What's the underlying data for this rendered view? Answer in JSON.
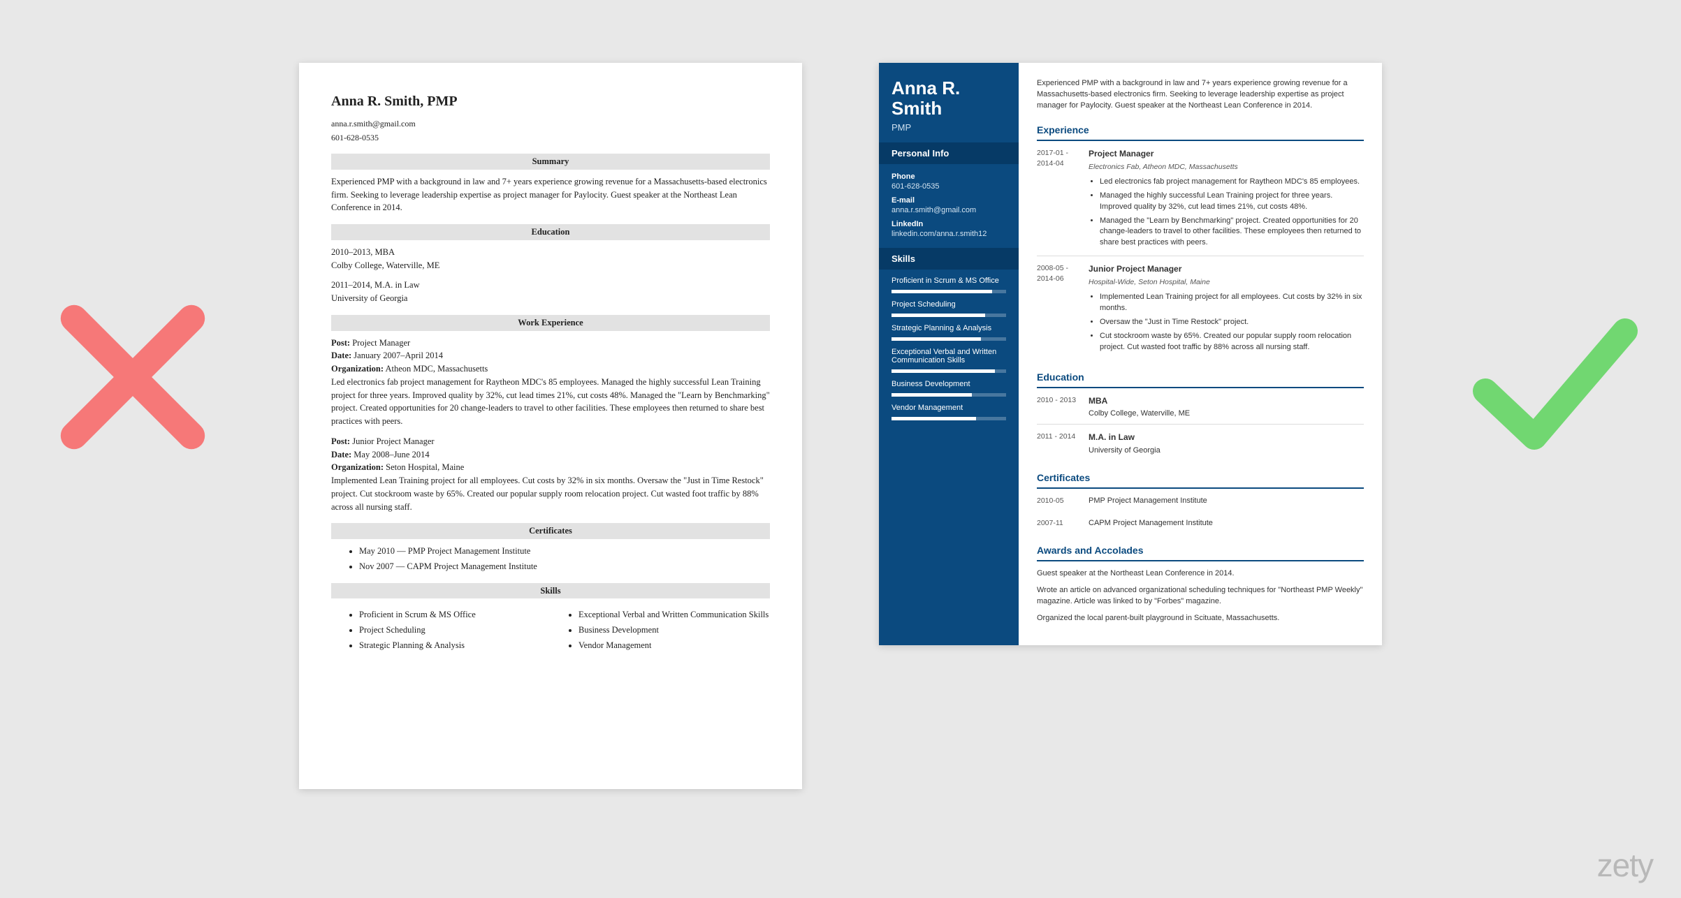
{
  "logo": "zety",
  "left": {
    "name": "Anna R. Smith, PMP",
    "email": "anna.r.smith@gmail.com",
    "phone": "601-628-0535",
    "sections": {
      "summary_h": "Summary",
      "summary": "Experienced PMP with a background in law and 7+ years experience growing revenue for a Massachusetts-based electronics firm. Seeking to leverage leadership expertise as project manager for Paylocity. Guest speaker at the Northeast Lean Conference in 2014.",
      "education_h": "Education",
      "edu1_dates": "2010–2013, MBA",
      "edu1_school": "Colby College, Waterville, ME",
      "edu2_dates": "2011–2014, M.A. in Law",
      "edu2_school": "University of Georgia",
      "work_h": "Work Experience",
      "job1_post_l": "Post:",
      "job1_post": "Project Manager",
      "job1_date_l": "Date:",
      "job1_date": "January 2007–April 2014",
      "job1_org_l": "Organization:",
      "job1_org": "Atheon MDC, Massachusetts",
      "job1_desc": "Led electronics fab project management for Raytheon MDC's 85 employees. Managed the highly successful Lean Training project for three years. Improved quality by 32%, cut lead times 21%, cut costs 48%. Managed the \"Learn by Benchmarking\" project. Created opportunities for 20 change-leaders to travel to other facilities. These employees then returned to share best practices with peers.",
      "job2_post_l": "Post:",
      "job2_post": "Junior Project Manager",
      "job2_date_l": "Date:",
      "job2_date": "May 2008–June 2014",
      "job2_org_l": "Organization:",
      "job2_org": "Seton Hospital, Maine",
      "job2_desc": "Implemented Lean Training project for all employees. Cut costs by 32% in six months. Oversaw the \"Just in Time Restock\" project. Cut stockroom waste by 65%. Created our popular supply room relocation project. Cut wasted foot traffic by 88% across all nursing staff.",
      "cert_h": "Certificates",
      "cert1": "May 2010 — PMP Project Management Institute",
      "cert2": "Nov 2007 — CAPM Project Management Institute",
      "skills_h": "Skills",
      "sk1": "Proficient in Scrum & MS Office",
      "sk2": "Project Scheduling",
      "sk3": "Strategic Planning & Analysis",
      "sk4": "Exceptional Verbal and Written Communication Skills",
      "sk5": "Business Development",
      "sk6": "Vendor Management"
    }
  },
  "right": {
    "name1": "Anna R.",
    "name2": "Smith",
    "cred": "PMP",
    "info_h": "Personal Info",
    "phone_l": "Phone",
    "phone": "601-628-0535",
    "email_l": "E-mail",
    "email": "anna.r.smith@gmail.com",
    "li_l": "LinkedIn",
    "li": "linkedin.com/anna.r.smith12",
    "skills_h": "Skills",
    "skills": [
      {
        "name": "Proficient in Scrum & MS Office",
        "pct": 88
      },
      {
        "name": "Project Scheduling",
        "pct": 82
      },
      {
        "name": "Strategic Planning & Analysis",
        "pct": 78
      },
      {
        "name": "Exceptional Verbal and Written Communication Skills",
        "pct": 90
      },
      {
        "name": "Business Development",
        "pct": 70
      },
      {
        "name": "Vendor Management",
        "pct": 74
      }
    ],
    "summary": "Experienced PMP with a background in law and 7+ years experience growing revenue for a Massachusetts-based electronics firm. Seeking to leverage leadership expertise as project manager for Paylocity. Guest speaker at the Northeast Lean Conference in 2014.",
    "exp_h": "Experience",
    "exp": [
      {
        "dates": "2017-01 - 2014-04",
        "title": "Project Manager",
        "sub": "Electronics Fab, Atheon MDC, Massachusetts",
        "bullets": [
          "Led electronics fab project management for Raytheon MDC's 85 employees.",
          "Managed the highly successful Lean Training project for three years. Improved quality by 32%, cut lead times 21%, cut costs 48%.",
          "Managed the \"Learn by Benchmarking\" project. Created opportunities for 20 change-leaders to travel to other facilities. These employees then returned to share best practices with peers."
        ]
      },
      {
        "dates": "2008-05 - 2014-06",
        "title": "Junior Project Manager",
        "sub": "Hospital-Wide, Seton Hospital, Maine",
        "bullets": [
          "Implemented Lean Training project for all employees. Cut costs by 32% in six months.",
          "Oversaw the \"Just in Time Restock\" project.",
          "Cut stockroom waste by 65%. Created our popular supply room relocation project. Cut wasted foot traffic by 88% across all nursing staff."
        ]
      }
    ],
    "edu_h": "Education",
    "edu": [
      {
        "dates": "2010 - 2013",
        "title": "MBA",
        "sub": "Colby College, Waterville, ME"
      },
      {
        "dates": "2011 - 2014",
        "title": "M.A. in Law",
        "sub": "University of Georgia"
      }
    ],
    "cert_h": "Certificates",
    "certs": [
      {
        "dates": "2010-05",
        "title": "PMP Project Management Institute"
      },
      {
        "dates": "2007-11",
        "title": "CAPM Project Management Institute"
      }
    ],
    "awards_h": "Awards and Accolades",
    "awards": [
      "Guest speaker at the Northeast Lean Conference in 2014.",
      "Wrote an article on advanced organizational scheduling techniques for \"Northeast PMP Weekly\" magazine. Article was linked to by \"Forbes\" magazine.",
      "Organized the local parent-built playground in Scituate, Massachusetts."
    ]
  }
}
